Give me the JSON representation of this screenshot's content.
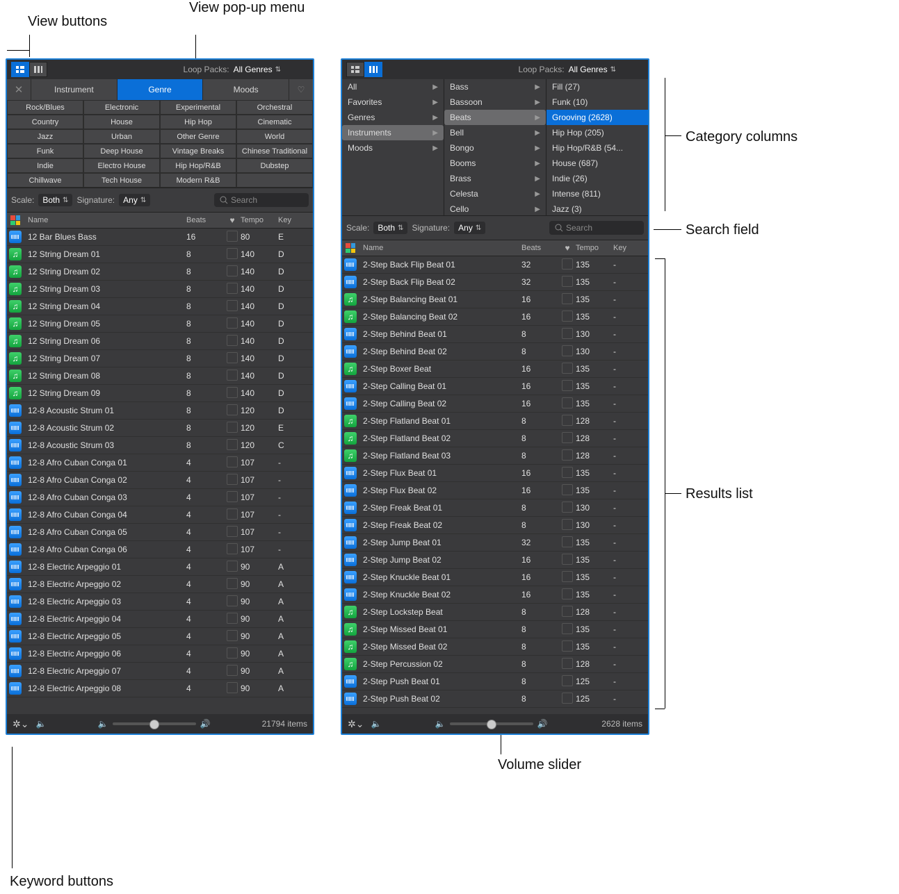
{
  "annotations": {
    "view_buttons": "View buttons",
    "view_popup": "View pop-up menu",
    "keyword_buttons": "Keyword buttons",
    "category_columns": "Category columns",
    "search_field": "Search field",
    "results_list": "Results list",
    "volume_slider": "Volume slider"
  },
  "shared": {
    "loop_packs_label": "Loop Packs:",
    "loop_packs_value": "All Genres",
    "scale_label": "Scale:",
    "scale_value": "Both",
    "signature_label": "Signature:",
    "signature_value": "Any",
    "search_placeholder": "Search",
    "columns": {
      "name": "Name",
      "beats": "Beats",
      "tempo": "Tempo",
      "key": "Key"
    }
  },
  "left": {
    "tabs": [
      "Instrument",
      "Genre",
      "Moods"
    ],
    "active_tab": 1,
    "keywords": [
      [
        "Rock/Blues",
        "Electronic",
        "Experimental",
        "Orchestral"
      ],
      [
        "Country",
        "House",
        "Hip Hop",
        "Cinematic"
      ],
      [
        "Jazz",
        "Urban",
        "Other Genre",
        "World"
      ],
      [
        "Funk",
        "Deep House",
        "Vintage Breaks",
        "Chinese Traditional"
      ],
      [
        "Indie",
        "Electro House",
        "Hip Hop/R&B",
        "Dubstep"
      ],
      [
        "Chillwave",
        "Tech House",
        "Modern R&B",
        ""
      ]
    ],
    "rows": [
      {
        "t": "b",
        "n": "12 Bar Blues Bass",
        "b": "16",
        "tp": "80",
        "k": "E"
      },
      {
        "t": "g",
        "n": "12 String Dream 01",
        "b": "8",
        "tp": "140",
        "k": "D"
      },
      {
        "t": "g",
        "n": "12 String Dream 02",
        "b": "8",
        "tp": "140",
        "k": "D"
      },
      {
        "t": "g",
        "n": "12 String Dream 03",
        "b": "8",
        "tp": "140",
        "k": "D"
      },
      {
        "t": "g",
        "n": "12 String Dream 04",
        "b": "8",
        "tp": "140",
        "k": "D"
      },
      {
        "t": "g",
        "n": "12 String Dream 05",
        "b": "8",
        "tp": "140",
        "k": "D"
      },
      {
        "t": "g",
        "n": "12 String Dream 06",
        "b": "8",
        "tp": "140",
        "k": "D"
      },
      {
        "t": "g",
        "n": "12 String Dream 07",
        "b": "8",
        "tp": "140",
        "k": "D"
      },
      {
        "t": "g",
        "n": "12 String Dream 08",
        "b": "8",
        "tp": "140",
        "k": "D"
      },
      {
        "t": "g",
        "n": "12 String Dream 09",
        "b": "8",
        "tp": "140",
        "k": "D"
      },
      {
        "t": "b",
        "n": "12-8 Acoustic Strum 01",
        "b": "8",
        "tp": "120",
        "k": "D"
      },
      {
        "t": "b",
        "n": "12-8 Acoustic Strum 02",
        "b": "8",
        "tp": "120",
        "k": "E"
      },
      {
        "t": "b",
        "n": "12-8 Acoustic Strum 03",
        "b": "8",
        "tp": "120",
        "k": "C"
      },
      {
        "t": "b",
        "n": "12-8 Afro Cuban Conga 01",
        "b": "4",
        "tp": "107",
        "k": "-"
      },
      {
        "t": "b",
        "n": "12-8 Afro Cuban Conga 02",
        "b": "4",
        "tp": "107",
        "k": "-"
      },
      {
        "t": "b",
        "n": "12-8 Afro Cuban Conga 03",
        "b": "4",
        "tp": "107",
        "k": "-"
      },
      {
        "t": "b",
        "n": "12-8 Afro Cuban Conga 04",
        "b": "4",
        "tp": "107",
        "k": "-"
      },
      {
        "t": "b",
        "n": "12-8 Afro Cuban Conga 05",
        "b": "4",
        "tp": "107",
        "k": "-"
      },
      {
        "t": "b",
        "n": "12-8 Afro Cuban Conga 06",
        "b": "4",
        "tp": "107",
        "k": "-"
      },
      {
        "t": "b",
        "n": "12-8 Electric Arpeggio 01",
        "b": "4",
        "tp": "90",
        "k": "A"
      },
      {
        "t": "b",
        "n": "12-8 Electric Arpeggio 02",
        "b": "4",
        "tp": "90",
        "k": "A"
      },
      {
        "t": "b",
        "n": "12-8 Electric Arpeggio 03",
        "b": "4",
        "tp": "90",
        "k": "A"
      },
      {
        "t": "b",
        "n": "12-8 Electric Arpeggio 04",
        "b": "4",
        "tp": "90",
        "k": "A"
      },
      {
        "t": "b",
        "n": "12-8 Electric Arpeggio 05",
        "b": "4",
        "tp": "90",
        "k": "A"
      },
      {
        "t": "b",
        "n": "12-8 Electric Arpeggio 06",
        "b": "4",
        "tp": "90",
        "k": "A"
      },
      {
        "t": "b",
        "n": "12-8 Electric Arpeggio 07",
        "b": "4",
        "tp": "90",
        "k": "A"
      },
      {
        "t": "b",
        "n": "12-8 Electric Arpeggio 08",
        "b": "4",
        "tp": "90",
        "k": "A"
      }
    ],
    "count": "21794 items"
  },
  "right": {
    "col1": [
      {
        "l": "All",
        "a": true,
        "s": false
      },
      {
        "l": "Favorites",
        "a": true,
        "s": false
      },
      {
        "l": "Genres",
        "a": true,
        "s": false
      },
      {
        "l": "Instruments",
        "a": true,
        "s": true
      },
      {
        "l": "Moods",
        "a": true,
        "s": false
      }
    ],
    "col2": [
      {
        "l": "Bass",
        "a": true
      },
      {
        "l": "Bassoon",
        "a": true
      },
      {
        "l": "Beats",
        "a": true,
        "s": true
      },
      {
        "l": "Bell",
        "a": true
      },
      {
        "l": "Bongo",
        "a": true
      },
      {
        "l": "Booms",
        "a": true
      },
      {
        "l": "Brass",
        "a": true
      },
      {
        "l": "Celesta",
        "a": true
      },
      {
        "l": "Cello",
        "a": true
      }
    ],
    "col3": [
      {
        "l": "Fill (27)"
      },
      {
        "l": "Funk (10)"
      },
      {
        "l": "Grooving (2628)",
        "sb": true
      },
      {
        "l": "Hip Hop (205)"
      },
      {
        "l": "Hip Hop/R&B (54..."
      },
      {
        "l": "House (687)"
      },
      {
        "l": "Indie (26)"
      },
      {
        "l": "Intense (811)"
      },
      {
        "l": "Jazz (3)"
      }
    ],
    "rows": [
      {
        "t": "b",
        "n": "2-Step Back Flip Beat 01",
        "b": "32",
        "tp": "135",
        "k": "-"
      },
      {
        "t": "b",
        "n": "2-Step Back Flip Beat 02",
        "b": "32",
        "tp": "135",
        "k": "-"
      },
      {
        "t": "g",
        "n": "2-Step Balancing Beat 01",
        "b": "16",
        "tp": "135",
        "k": "-"
      },
      {
        "t": "g",
        "n": "2-Step Balancing Beat 02",
        "b": "16",
        "tp": "135",
        "k": "-"
      },
      {
        "t": "b",
        "n": "2-Step Behind Beat 01",
        "b": "8",
        "tp": "130",
        "k": "-"
      },
      {
        "t": "b",
        "n": "2-Step Behind Beat 02",
        "b": "8",
        "tp": "130",
        "k": "-"
      },
      {
        "t": "g",
        "n": "2-Step Boxer Beat",
        "b": "16",
        "tp": "135",
        "k": "-"
      },
      {
        "t": "b",
        "n": "2-Step Calling Beat 01",
        "b": "16",
        "tp": "135",
        "k": "-"
      },
      {
        "t": "b",
        "n": "2-Step Calling Beat 02",
        "b": "16",
        "tp": "135",
        "k": "-"
      },
      {
        "t": "g",
        "n": "2-Step Flatland Beat 01",
        "b": "8",
        "tp": "128",
        "k": "-"
      },
      {
        "t": "g",
        "n": "2-Step Flatland Beat 02",
        "b": "8",
        "tp": "128",
        "k": "-"
      },
      {
        "t": "g",
        "n": "2-Step Flatland Beat 03",
        "b": "8",
        "tp": "128",
        "k": "-"
      },
      {
        "t": "b",
        "n": "2-Step Flux Beat 01",
        "b": "16",
        "tp": "135",
        "k": "-"
      },
      {
        "t": "b",
        "n": "2-Step Flux Beat 02",
        "b": "16",
        "tp": "135",
        "k": "-"
      },
      {
        "t": "b",
        "n": "2-Step Freak Beat 01",
        "b": "8",
        "tp": "130",
        "k": "-"
      },
      {
        "t": "b",
        "n": "2-Step Freak Beat 02",
        "b": "8",
        "tp": "130",
        "k": "-"
      },
      {
        "t": "b",
        "n": "2-Step Jump Beat 01",
        "b": "32",
        "tp": "135",
        "k": "-"
      },
      {
        "t": "b",
        "n": "2-Step Jump Beat 02",
        "b": "16",
        "tp": "135",
        "k": "-"
      },
      {
        "t": "b",
        "n": "2-Step Knuckle Beat 01",
        "b": "16",
        "tp": "135",
        "k": "-"
      },
      {
        "t": "b",
        "n": "2-Step Knuckle Beat 02",
        "b": "16",
        "tp": "135",
        "k": "-"
      },
      {
        "t": "g",
        "n": "2-Step Lockstep Beat",
        "b": "8",
        "tp": "128",
        "k": "-"
      },
      {
        "t": "g",
        "n": "2-Step Missed Beat 01",
        "b": "8",
        "tp": "135",
        "k": "-"
      },
      {
        "t": "g",
        "n": "2-Step Missed Beat 02",
        "b": "8",
        "tp": "135",
        "k": "-"
      },
      {
        "t": "g",
        "n": "2-Step Percussion 02",
        "b": "8",
        "tp": "128",
        "k": "-"
      },
      {
        "t": "b",
        "n": "2-Step Push Beat 01",
        "b": "8",
        "tp": "125",
        "k": "-"
      },
      {
        "t": "b",
        "n": "2-Step Push Beat 02",
        "b": "8",
        "tp": "125",
        "k": "-"
      }
    ],
    "count": "2628 items"
  }
}
